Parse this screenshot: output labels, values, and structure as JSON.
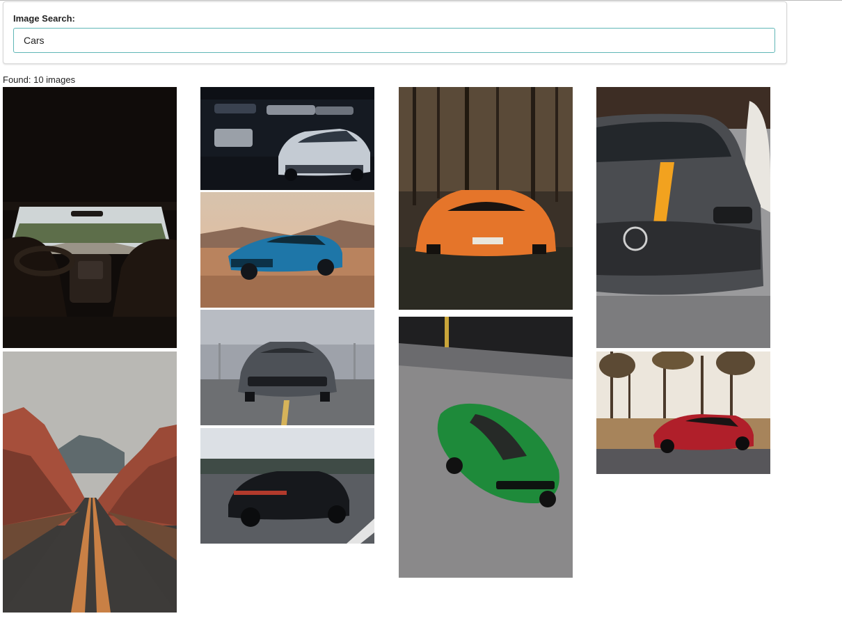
{
  "search": {
    "label": "Image Search:",
    "value": "Cars"
  },
  "results": {
    "found_text": "Found: 10 images"
  },
  "images": [
    {
      "subject": "car interior view through windshield onto road"
    },
    {
      "subject": "desert road through red rock canyon"
    },
    {
      "subject": "white muscle car in dark garage"
    },
    {
      "subject": "blue sports car on desert sand"
    },
    {
      "subject": "gray muscle car front view on tarmac"
    },
    {
      "subject": "black luxury sedan driving on highway"
    },
    {
      "subject": "orange supercar in forest"
    },
    {
      "subject": "green sports car from above on pavement"
    },
    {
      "subject": "gray coupe with yellow stripe front close-up"
    },
    {
      "subject": "red sports coupe near pine forest"
    }
  ]
}
